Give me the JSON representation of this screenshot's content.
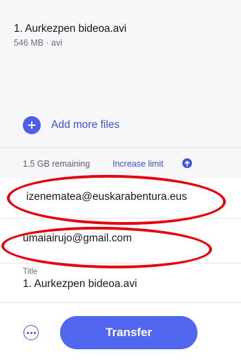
{
  "file": {
    "name": "1. Aurkezpen bideoa.avi",
    "meta": "546 MB · avi"
  },
  "add_more": {
    "label": "Add more files",
    "icon": "plus-icon"
  },
  "storage": {
    "remaining": "1.5 GB remaining",
    "increase_label": "Increase limit",
    "icon": "arrow-up-icon"
  },
  "recipient": {
    "email": "izenematea@euskarabentura.eus"
  },
  "sender": {
    "email": "umaiairujo@gmail.com"
  },
  "title_field": {
    "label": "Title",
    "value": "1. Aurkezpen bideoa.avi"
  },
  "footer": {
    "transfer_label": "Transfer",
    "more_icon": "ellipsis-icon"
  },
  "colors": {
    "accent": "#5267f0",
    "link": "#3b4fe0",
    "annotation": "#e4000f"
  }
}
